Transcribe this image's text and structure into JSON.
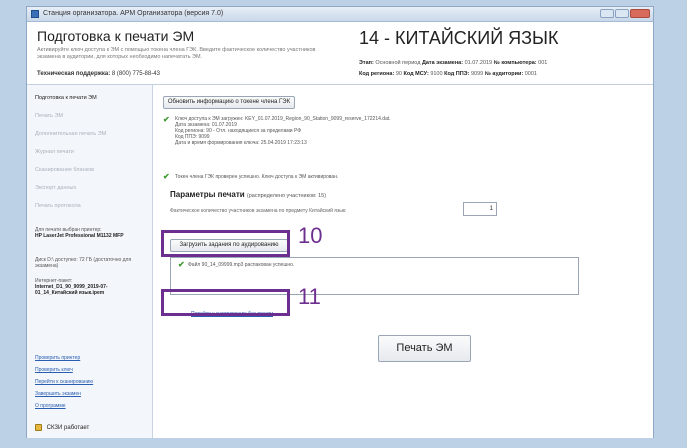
{
  "window": {
    "title": "Станция организатора. АРМ Организатора (версия 7.0)"
  },
  "header": {
    "title": "Подготовка к печати ЭМ",
    "description": "Активируйте ключ доступа к ЭМ с помощью токена члена ГЭК. Введите фактическое количество участников экзамена в аудитории, для которых необходимо напечатать ЭМ.",
    "support_label": "Техническая поддержка:",
    "support_value": "8 (800) 775-88-43",
    "subject": "14 - КИТАЙСКИЙ ЯЗЫК",
    "meta_line1": [
      {
        "label": "Этап:",
        "value": "Основной период"
      },
      {
        "label": "Дата экзамена:",
        "value": "01.07.2019"
      },
      {
        "label": "№ компьютера:",
        "value": "001"
      }
    ],
    "meta_line2": [
      {
        "label": "Код региона:",
        "value": "90"
      },
      {
        "label": "Код МСУ:",
        "value": "9100"
      },
      {
        "label": "Код ППЭ:",
        "value": "9099"
      },
      {
        "label": "№ аудитории:",
        "value": "0001"
      }
    ]
  },
  "sidebar": {
    "nav": [
      "Подготовка к печати ЭМ",
      "Печать ЭМ",
      "Дополнительная печать ЭМ",
      "Журнал печати",
      "Сканирование бланков",
      "Экспорт данных",
      "Печать протокола"
    ],
    "printer_label": "Для печати выбран принтер:",
    "printer_name": "HP LaserJet Professional M1132 MFP",
    "disk_info": "Диск D:\\ доступно: 72 ГБ (достаточно для экзамена)",
    "internet_label": "Интернет-пакет:",
    "internet_value": "Internet_D1_90_9099_2019-07-01_14_Китайский язык.ipem",
    "links": [
      "Проверить принтер",
      "Проверить ключ",
      "Перейти к сканированию",
      "Завершить экзамен",
      "О программе"
    ],
    "status": "СКЗИ работает"
  },
  "main": {
    "refresh_button": "Обновить информацию о токене члена ГЭК",
    "key_info": [
      "Ключ доступа к ЭМ загружен: KEY_01.07.2019_Region_90_Station_9099_reserve_172214.dat.",
      "Дата экзамена: 01.07.2019",
      "Код региона: 90 - Отл. находящиеся за пределами РФ",
      "Код ППЭ: 9099",
      "Дата и время формирования ключа: 25.04.2019 17:23:13"
    ],
    "token_ok": "Токен члена ГЭК проверен успешно. Ключ доступа к ЭМ активирован.",
    "params_title": "Параметры печати",
    "params_note": "(распределено участников: 15)",
    "quantity_label": "Фактическое количество участников экзамена по предмету Китайский язык:",
    "quantity_value": "1",
    "load_button": "Загрузить задания по аудированию",
    "load_result": "Файл 90_14_09999.mp3 распакован успешно.",
    "skip_link": "Перейти к аудированию без печати",
    "print_button": "Печать ЭМ"
  },
  "annotations": {
    "callout1": "10",
    "callout2": "11"
  }
}
